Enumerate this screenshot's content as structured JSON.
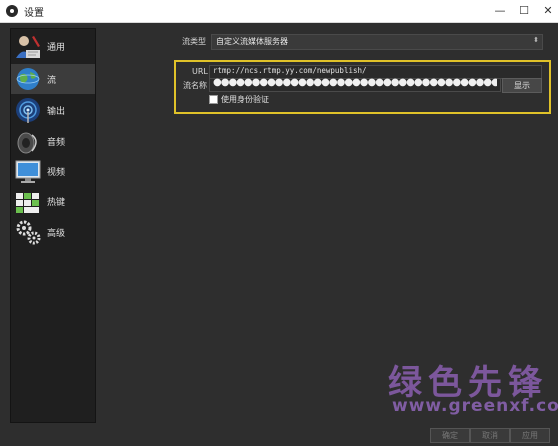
{
  "window": {
    "title": "设置",
    "min": "—",
    "max": "☐",
    "close": "✕"
  },
  "sidebar": {
    "items": [
      {
        "label": "通用",
        "icon": "user-icon"
      },
      {
        "label": "流",
        "icon": "globe-icon"
      },
      {
        "label": "输出",
        "icon": "broadcast-icon"
      },
      {
        "label": "音频",
        "icon": "speaker-icon"
      },
      {
        "label": "视频",
        "icon": "monitor-icon"
      },
      {
        "label": "热键",
        "icon": "keyboard-icon"
      },
      {
        "label": "高级",
        "icon": "gears-icon"
      }
    ],
    "active_index": 1
  },
  "stream": {
    "type_label": "流类型",
    "type_value": "自定义流媒体服务器",
    "url_label": "URL",
    "url_value": "rtmp://ncs.rtmp.yy.com/newpublish/",
    "key_label": "流名称",
    "key_value": "●●●●●●●●●●●●●●●●●●●●●●●●●●●●●●●●●●●●●●●●●●●●●●●●●",
    "show_button": "显示",
    "auth_label": "使用身份验证",
    "auth_checked": false
  },
  "footer": {
    "ok": "确定",
    "cancel": "取消",
    "apply": "应用"
  },
  "watermark": {
    "cn": "绿色先锋",
    "en": "www.greenxf.com"
  },
  "colors": {
    "highlight": "#e0c229",
    "background": "#2e2e2e",
    "sidebar": "#1f1f1f"
  }
}
